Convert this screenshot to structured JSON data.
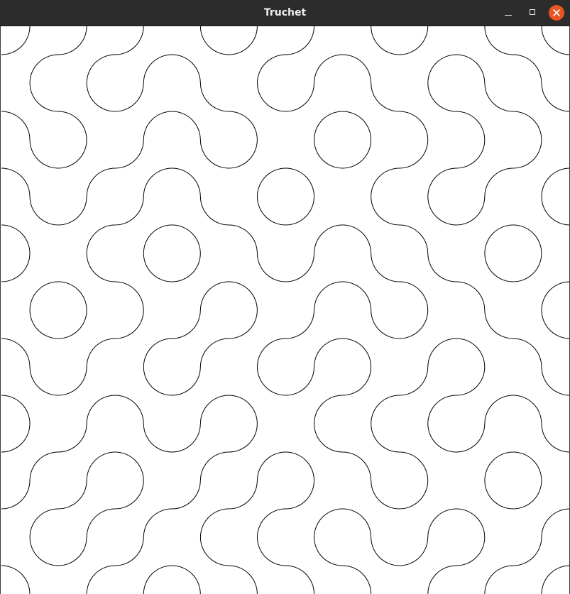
{
  "window": {
    "title": "Truchet",
    "buttons": {
      "minimize": "minimize-icon",
      "maximize": "maximize-icon",
      "close": "close-icon"
    },
    "colors": {
      "titlebar": "#2c2c2c",
      "title_text": "#eeeeee",
      "close_button": "#e95420"
    }
  },
  "pattern": {
    "kind": "truchet-arcs",
    "grid_cols": 10,
    "grid_rows": 10,
    "stroke_color": "#000000",
    "background_color": "#ffffff"
  }
}
